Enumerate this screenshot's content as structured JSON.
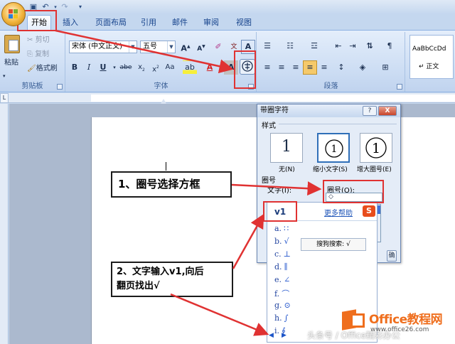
{
  "tabs": [
    {
      "label": "开始",
      "active": true
    },
    {
      "label": "插入"
    },
    {
      "label": "页面布局"
    },
    {
      "label": "引用"
    },
    {
      "label": "邮件"
    },
    {
      "label": "审阅"
    },
    {
      "label": "视图"
    }
  ],
  "clipboard": {
    "paste_label": "粘贴",
    "cut_label": "剪切",
    "copy_label": "复制",
    "format_painter_label": "格式刷",
    "group_label": "剪贴板"
  },
  "font": {
    "font_name": "宋体 (中文正文)",
    "font_size": "五号",
    "group_label": "字体"
  },
  "paragraph": {
    "group_label": "段落"
  },
  "styles": {
    "preview_text": "AaBbCcDd",
    "style_name": "↵ 正文"
  },
  "dialog": {
    "title": "带圈字符",
    "help_btn": "?",
    "close_btn": "X",
    "style_section": "样式",
    "style_options": [
      "无(N)",
      "缩小文字(S)",
      "增大圈号(E)"
    ],
    "enclosure_section": "圈号",
    "text_label": "文字(I):",
    "enclosure_label": "圈号(O):",
    "enclosure_value": "◇",
    "ok_btn": "确"
  },
  "ime": {
    "input_text": "v1",
    "more_help": "更多帮助",
    "search_tip": "搜狗搜索: √",
    "candidates": [
      {
        "n": "a.",
        "s": "∷"
      },
      {
        "n": "b.",
        "s": "√"
      },
      {
        "n": "c.",
        "s": "⊥"
      },
      {
        "n": "d.",
        "s": "∥"
      },
      {
        "n": "e.",
        "s": "∠"
      },
      {
        "n": "f.",
        "s": "⌒"
      },
      {
        "n": "g.",
        "s": "⊙"
      },
      {
        "n": "h.",
        "s": "∫"
      },
      {
        "n": "i.",
        "s": "∮"
      }
    ]
  },
  "annotations": {
    "step1": "1、圈号选择方框",
    "step2_line1": "2、文字输入v1,向后",
    "step2_line2": "翻页找出√"
  },
  "watermark": {
    "brand": "Office教程网",
    "url": "www.office26.com",
    "credit": "头条号 / Office精彩办公"
  },
  "colors": {
    "annotation_red": "#e03232",
    "ribbon_blue": "#c4d7ef",
    "brand_orange": "#ef6e1d"
  }
}
